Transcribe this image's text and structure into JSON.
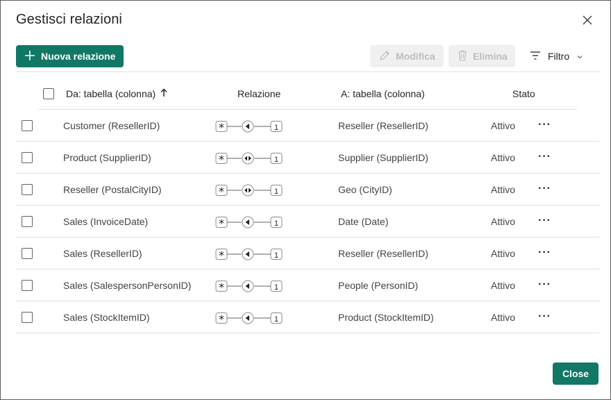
{
  "dialog": {
    "title": "Gestisci relazioni",
    "close_label": "Close"
  },
  "toolbar": {
    "new_label": "Nuova relazione",
    "edit_label": "Modifica",
    "delete_label": "Elimina",
    "filter_label": "Filtro"
  },
  "table": {
    "headers": {
      "from": "Da: tabella (colonna)",
      "relation": "Relazione",
      "to": "A: tabella (colonna)",
      "status": "Stato"
    },
    "sort": "ascending",
    "rows": [
      {
        "from": "Customer (ResellerID)",
        "to": "Reseller (ResellerID)",
        "status": "Attivo",
        "left": "*",
        "right": "1",
        "direction": "single"
      },
      {
        "from": "Product (SupplierID)",
        "to": "Supplier (SupplierID)",
        "status": "Attivo",
        "left": "*",
        "right": "1",
        "direction": "both"
      },
      {
        "from": "Reseller (PostalCityID)",
        "to": "Geo (CityID)",
        "status": "Attivo",
        "left": "*",
        "right": "1",
        "direction": "both"
      },
      {
        "from": "Sales (InvoiceDate)",
        "to": "Date (Date)",
        "status": "Attivo",
        "left": "*",
        "right": "1",
        "direction": "single"
      },
      {
        "from": "Sales (ResellerID)",
        "to": "Reseller (ResellerID)",
        "status": "Attivo",
        "left": "*",
        "right": "1",
        "direction": "single"
      },
      {
        "from": "Sales (SalespersonPersonID)",
        "to": "People (PersonID)",
        "status": "Attivo",
        "left": "*",
        "right": "1",
        "direction": "single"
      },
      {
        "from": "Sales (StockItemID)",
        "to": "Product (StockItemID)",
        "status": "Attivo",
        "left": "*",
        "right": "1",
        "direction": "single"
      }
    ]
  },
  "colors": {
    "accent": "#117865",
    "disabled_bg": "#f0f0f0",
    "disabled_text": "#bdbdbd",
    "divider": "#e0e0e0"
  },
  "icons": {
    "add": "plus-icon",
    "edit": "pencil-icon",
    "delete": "trash-icon",
    "filter": "filter-icon",
    "close": "close-icon",
    "sort": "arrow-up-icon",
    "more": "more-icon"
  }
}
